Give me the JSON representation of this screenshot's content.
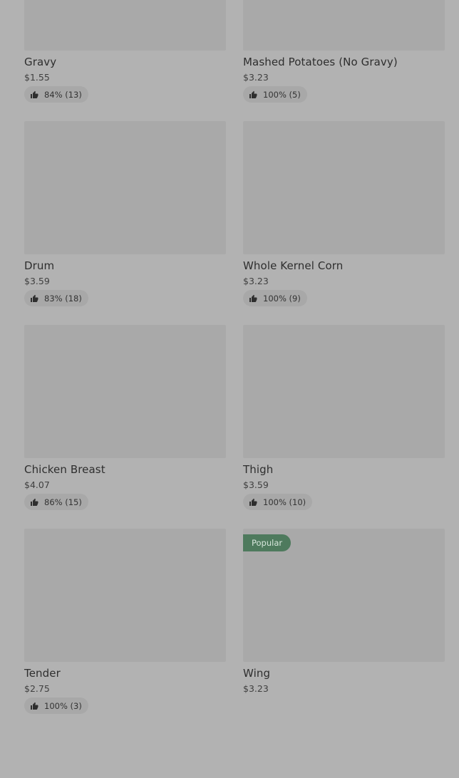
{
  "items": [
    {
      "name": "Gravy",
      "price": "$1.55",
      "rating": "84% (13)"
    },
    {
      "name": "Mashed Potatoes (No Gravy)",
      "price": "$3.23",
      "rating": "100% (5)"
    },
    {
      "name": "Drum",
      "price": "$3.59",
      "rating": "83% (18)"
    },
    {
      "name": "Whole Kernel Corn",
      "price": "$3.23",
      "rating": "100% (9)"
    },
    {
      "name": "Chicken Breast",
      "price": "$4.07",
      "rating": "86% (15)"
    },
    {
      "name": "Thigh",
      "price": "$3.59",
      "rating": "100% (10)"
    },
    {
      "name": "Tender",
      "price": "$2.75",
      "rating": "100% (3)"
    },
    {
      "name": "Wing",
      "price": "$3.23",
      "rating": "",
      "badge": "Popular"
    }
  ],
  "icons": {
    "rating": "thumbs-up-icon"
  },
  "colors": {
    "badge": "#4e7a5d",
    "background": "#b2b2b2",
    "thumb": "#a9a9a9"
  }
}
